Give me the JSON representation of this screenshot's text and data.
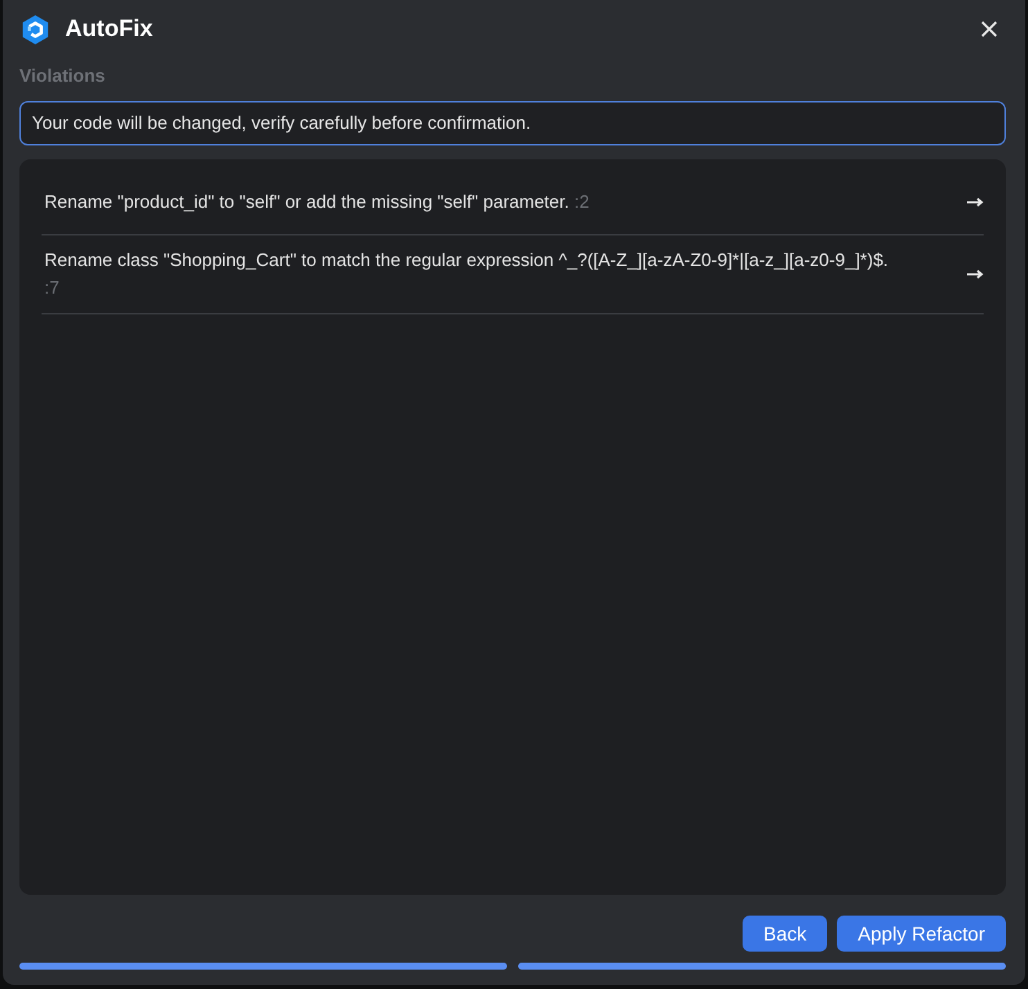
{
  "window": {
    "title": "AutoFix"
  },
  "section_label": "Violations",
  "notice": "Your code will be changed, verify carefully before confirmation.",
  "violations": [
    {
      "message": "Rename \"product_id\" to \"self\" or add the missing \"self\" parameter.",
      "line": ":2"
    },
    {
      "message": "Rename class \"Shopping_Cart\" to match the regular expression ^_?([A-Z_][a-zA-Z0-9]*|[a-z_][a-z0-9_]*)$.",
      "line": ":7"
    }
  ],
  "buttons": [
    {
      "label": "Back"
    },
    {
      "label": "Apply Refactor"
    }
  ]
}
